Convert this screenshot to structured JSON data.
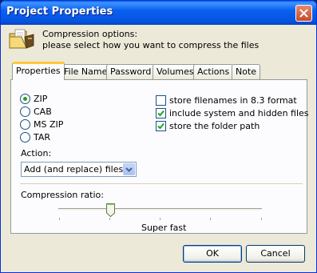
{
  "window": {
    "title": "Project Properties"
  },
  "header": {
    "line1": "Compression options:",
    "line2": "please select how you want to compress the files",
    "icon": "folder-icon"
  },
  "tabs": [
    {
      "label": "Properties",
      "active": true
    },
    {
      "label": "File Name",
      "active": false
    },
    {
      "label": "Password",
      "active": false
    },
    {
      "label": "Volumes",
      "active": false
    },
    {
      "label": "Actions",
      "active": false
    },
    {
      "label": "Note",
      "active": false
    }
  ],
  "properties": {
    "formats": [
      {
        "label": "ZIP",
        "selected": true
      },
      {
        "label": "CAB",
        "selected": false
      },
      {
        "label": "MS ZIP",
        "selected": false
      },
      {
        "label": "TAR",
        "selected": false
      }
    ],
    "options": [
      {
        "label": "store filenames in 8.3 format",
        "checked": false
      },
      {
        "label": "include system and hidden files",
        "checked": true
      },
      {
        "label": "store the folder path",
        "checked": true
      }
    ],
    "action_label": "Action:",
    "action_value": "Add (and replace) files",
    "compression_label": "Compression ratio:",
    "compression_value_label": "Super fast",
    "compression_level": 0.25
  },
  "buttons": {
    "ok": "OK",
    "cancel": "Cancel"
  },
  "colors": {
    "titlebar": "#0553e0",
    "tab_highlight": "#ffc83c",
    "check_mark": "#21a121"
  }
}
